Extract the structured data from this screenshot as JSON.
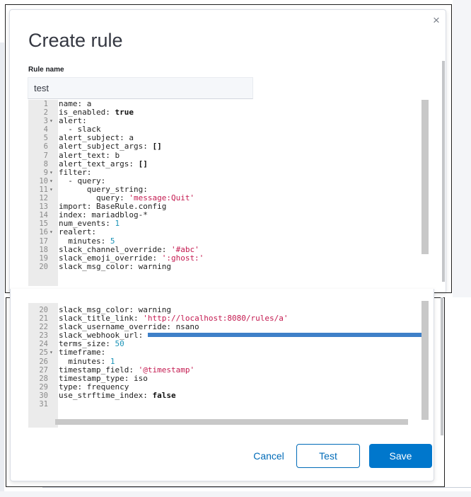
{
  "modal": {
    "title": "Create rule",
    "close_glyph": "×",
    "close_icon": "close-icon"
  },
  "form": {
    "rule_name_label": "Rule name",
    "rule_name_value": "test"
  },
  "editor": {
    "top_lines": [
      {
        "n": "1",
        "fold": "",
        "segs": [
          {
            "t": "name: a",
            "c": ""
          }
        ]
      },
      {
        "n": "2",
        "fold": "",
        "segs": [
          {
            "t": "is_enabled: ",
            "c": ""
          },
          {
            "t": "true",
            "c": "kw"
          }
        ]
      },
      {
        "n": "3",
        "fold": "▾",
        "segs": [
          {
            "t": "alert:",
            "c": ""
          }
        ]
      },
      {
        "n": "4",
        "fold": "",
        "segs": [
          {
            "t": "  - slack",
            "c": ""
          }
        ]
      },
      {
        "n": "5",
        "fold": "",
        "segs": [
          {
            "t": "alert_subject: a",
            "c": ""
          }
        ]
      },
      {
        "n": "6",
        "fold": "",
        "segs": [
          {
            "t": "alert_subject_args: ",
            "c": ""
          },
          {
            "t": "[]",
            "c": "kw"
          }
        ]
      },
      {
        "n": "7",
        "fold": "",
        "segs": [
          {
            "t": "alert_text: b",
            "c": ""
          }
        ]
      },
      {
        "n": "8",
        "fold": "",
        "segs": [
          {
            "t": "alert_text_args: ",
            "c": ""
          },
          {
            "t": "[]",
            "c": "kw"
          }
        ]
      },
      {
        "n": "9",
        "fold": "▾",
        "segs": [
          {
            "t": "filter:",
            "c": ""
          }
        ]
      },
      {
        "n": "10",
        "fold": "▾",
        "segs": [
          {
            "t": "  - query:",
            "c": ""
          }
        ]
      },
      {
        "n": "11",
        "fold": "▾",
        "segs": [
          {
            "t": "      query_string:",
            "c": ""
          }
        ]
      },
      {
        "n": "12",
        "fold": "",
        "segs": [
          {
            "t": "        query: ",
            "c": ""
          },
          {
            "t": "'message:Quit'",
            "c": "str"
          }
        ]
      },
      {
        "n": "13",
        "fold": "",
        "segs": [
          {
            "t": "import: BaseRule.config",
            "c": ""
          }
        ]
      },
      {
        "n": "14",
        "fold": "",
        "segs": [
          {
            "t": "index: mariadblog-*",
            "c": ""
          }
        ]
      },
      {
        "n": "15",
        "fold": "",
        "segs": [
          {
            "t": "num_events: ",
            "c": ""
          },
          {
            "t": "1",
            "c": "num"
          }
        ]
      },
      {
        "n": "16",
        "fold": "▾",
        "segs": [
          {
            "t": "realert:",
            "c": ""
          }
        ]
      },
      {
        "n": "17",
        "fold": "",
        "segs": [
          {
            "t": "  minutes: ",
            "c": ""
          },
          {
            "t": "5",
            "c": "num"
          }
        ]
      },
      {
        "n": "18",
        "fold": "",
        "segs": [
          {
            "t": "slack_channel_override: ",
            "c": ""
          },
          {
            "t": "'#abc'",
            "c": "str"
          }
        ]
      },
      {
        "n": "19",
        "fold": "",
        "segs": [
          {
            "t": "slack_emoji_override: ",
            "c": ""
          },
          {
            "t": "':ghost:'",
            "c": "str"
          }
        ]
      },
      {
        "n": "20",
        "fold": "",
        "segs": [
          {
            "t": "slack_msg_color: warning",
            "c": ""
          }
        ]
      }
    ],
    "bottom_lines": [
      {
        "n": "20",
        "fold": "",
        "segs": [
          {
            "t": "slack_msg_color: warning",
            "c": ""
          }
        ]
      },
      {
        "n": "21",
        "fold": "",
        "segs": [
          {
            "t": "slack_title_link: ",
            "c": ""
          },
          {
            "t": "'http://localhost:8080/rules/a'",
            "c": "str"
          }
        ]
      },
      {
        "n": "22",
        "fold": "",
        "segs": [
          {
            "t": "slack_username_override: nsano",
            "c": ""
          }
        ]
      },
      {
        "n": "23",
        "fold": "",
        "segs": [
          {
            "t": "slack_webhook_url: ",
            "c": ""
          },
          {
            "t": "",
            "c": "redact"
          }
        ]
      },
      {
        "n": "24",
        "fold": "",
        "segs": [
          {
            "t": "terms_size: ",
            "c": ""
          },
          {
            "t": "50",
            "c": "num"
          }
        ]
      },
      {
        "n": "25",
        "fold": "▾",
        "segs": [
          {
            "t": "timeframe:",
            "c": ""
          }
        ]
      },
      {
        "n": "26",
        "fold": "",
        "segs": [
          {
            "t": "  minutes: ",
            "c": ""
          },
          {
            "t": "1",
            "c": "num"
          }
        ]
      },
      {
        "n": "27",
        "fold": "",
        "segs": [
          {
            "t": "timestamp_field: ",
            "c": ""
          },
          {
            "t": "'@timestamp'",
            "c": "str"
          }
        ]
      },
      {
        "n": "28",
        "fold": "",
        "segs": [
          {
            "t": "timestamp_type: iso",
            "c": ""
          }
        ]
      },
      {
        "n": "29",
        "fold": "",
        "segs": [
          {
            "t": "type: frequency",
            "c": ""
          }
        ]
      },
      {
        "n": "30",
        "fold": "",
        "segs": [
          {
            "t": "use_strftime_index: ",
            "c": ""
          },
          {
            "t": "false",
            "c": "kw"
          }
        ]
      },
      {
        "n": "31",
        "fold": "",
        "segs": [
          {
            "t": "",
            "c": ""
          }
        ]
      }
    ]
  },
  "footer": {
    "cancel_label": "Cancel",
    "test_label": "Test",
    "save_label": "Save"
  },
  "colors": {
    "accent": "#0077cc",
    "link": "#006bb8",
    "string": "#c41a50",
    "number": "#1c94b8",
    "redaction": "#3f80c8"
  }
}
